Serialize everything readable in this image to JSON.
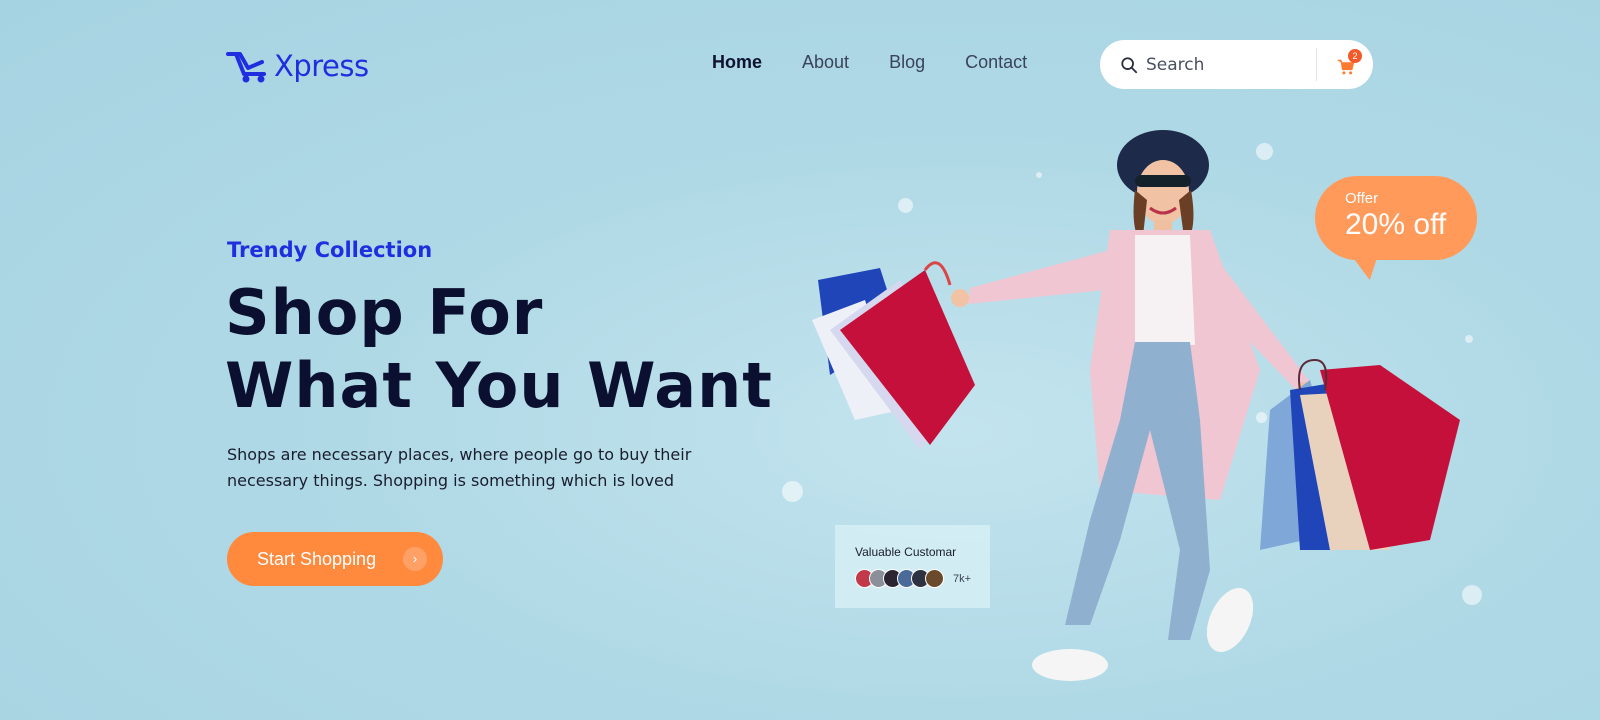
{
  "brand": {
    "name": "Xpress",
    "color": "#1f2fe0"
  },
  "nav": {
    "items": [
      {
        "label": "Home",
        "active": true
      },
      {
        "label": "About",
        "active": false
      },
      {
        "label": "Blog",
        "active": false
      },
      {
        "label": "Contact",
        "active": false
      }
    ]
  },
  "search": {
    "placeholder": "Search",
    "icon": "search-icon"
  },
  "cart": {
    "icon": "cart-icon",
    "badge": "2"
  },
  "hero": {
    "eyebrow": "Trendy Collection",
    "headline_line1": "Shop For",
    "headline_line2": "What You Want",
    "description": "Shops are necessary places, where people go to buy their necessary things. Shopping is something which is loved",
    "cta_label": "Start Shopping",
    "cta_icon": "chevron-right-icon",
    "accent": "#ff8a3d"
  },
  "offer": {
    "label": "Offer",
    "value": "20% off"
  },
  "customers": {
    "title": "Valuable Customar",
    "count": "7k+"
  }
}
